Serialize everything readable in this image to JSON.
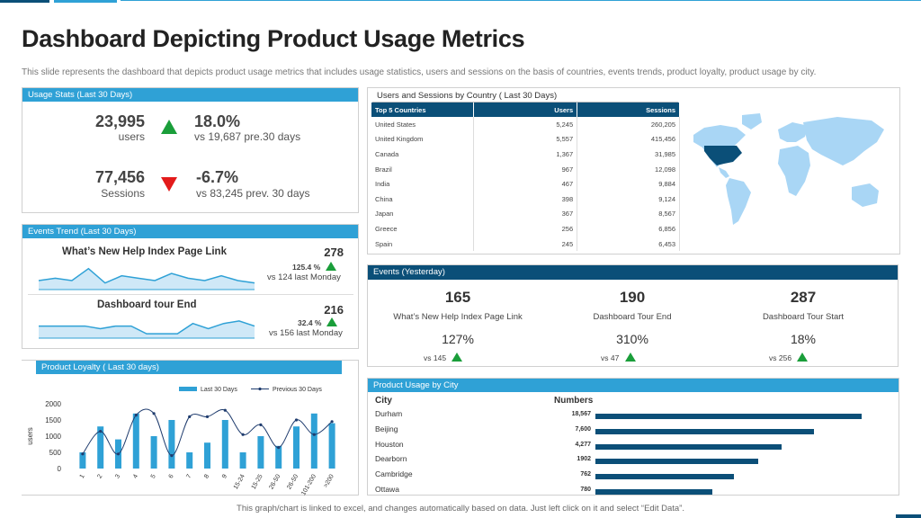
{
  "title": "Dashboard Depicting Product Usage Metrics",
  "subtitle": "This slide represents the dashboard that depicts product usage metrics that includes usage statistics, users and sessions on the basis of countries, events trends, product loyalty, product usage by city.",
  "usage_stats": {
    "header": "Usage Stats (Last 30 Days)",
    "users_value": "23,995",
    "users_label": "users",
    "users_change": "18.0%",
    "users_compare": "vs 19,687 pre.30 days",
    "sessions_value": "77,456",
    "sessions_label": "Sessions",
    "sessions_change": "-6.7%",
    "sessions_compare": "vs 83,245 prev. 30 days"
  },
  "events_trend": {
    "header": "Events Trend (Last 30 Days)",
    "item1_title": "What’s New Help Index  Page Link",
    "item1_value": "278",
    "item1_pct": "125.4 %",
    "item1_compare": "vs 124 last Monday",
    "item1_spark": [
      3,
      4,
      3,
      8,
      2,
      5,
      4,
      3,
      6,
      4,
      3,
      5,
      3,
      2
    ],
    "item2_title": "Dashboard tour End",
    "item2_value": "216",
    "item2_pct": "32.4 %",
    "item2_compare": "vs 156 last Monday",
    "item2_spark": [
      4,
      4,
      4,
      4,
      3,
      4,
      4,
      1,
      1,
      1,
      5,
      3,
      5,
      6,
      4
    ]
  },
  "users_sessions": {
    "header": "Users and Sessions by Country ( Last 30 Days)",
    "col_country": "Top 5 Countries",
    "col_users": "Users",
    "col_sessions": "Sessions",
    "rows": [
      {
        "country": "United States",
        "users": "5,245",
        "sessions": "260,205"
      },
      {
        "country": "United Kingdom",
        "users": "5,557",
        "sessions": "415,456"
      },
      {
        "country": "Canada",
        "users": "1,367",
        "sessions": "31,985"
      },
      {
        "country": "Brazil",
        "users": "967",
        "sessions": "12,098"
      },
      {
        "country": "India",
        "users": "467",
        "sessions": "9,884"
      },
      {
        "country": "China",
        "users": "398",
        "sessions": "9,124"
      },
      {
        "country": "Japan",
        "users": "367",
        "sessions": "8,567"
      },
      {
        "country": "Greece",
        "users": "256",
        "sessions": "6,856"
      },
      {
        "country": "Spain",
        "users": "245",
        "sessions": "6,453"
      }
    ],
    "map_colors": {
      "highlight": "#0b4f78",
      "land": "#a9d6f5"
    }
  },
  "events_yesterday": {
    "header": "Events (Yesterday)",
    "items": [
      {
        "value": "165",
        "label": "What’s New Help Index Page Link",
        "pct": "127%",
        "compare": "vs 145"
      },
      {
        "value": "190",
        "label": "Dashboard Tour End",
        "pct": "310%",
        "compare": "vs 47"
      },
      {
        "value": "287",
        "label": "Dashboard Tour Start",
        "pct": "18%",
        "compare": "vs 256"
      }
    ]
  },
  "product_loyalty": {
    "header": "Product Loyalty ( Last 30 days)",
    "legend_bar": "Last 30 Days",
    "legend_line": "Previous 30 Days",
    "ylabel": "users",
    "yticks": [
      "2000",
      "1500",
      "1000",
      "500",
      "0"
    ]
  },
  "chart_data": {
    "type": "bar",
    "categories": [
      "1",
      "2",
      "3",
      "4",
      "5",
      "6",
      "7",
      "8",
      "9",
      "15-24",
      "15-25",
      "26-50",
      "26-50",
      "101-200",
      ">200"
    ],
    "series": [
      {
        "name": "Last 30 Days",
        "type": "bar",
        "values": [
          500,
          1300,
          900,
          1700,
          1000,
          1500,
          500,
          800,
          1500,
          500,
          1000,
          700,
          1300,
          1700,
          1400
        ]
      },
      {
        "name": "Previous 30 Days",
        "type": "line",
        "values": [
          450,
          1150,
          450,
          1650,
          1700,
          400,
          1600,
          1600,
          1800,
          1050,
          1350,
          650,
          1500,
          1050,
          1450
        ]
      }
    ],
    "ylabel": "users",
    "ylim": [
      0,
      2000
    ],
    "legend": "top",
    "colors": {
      "bar": "#2fa1d6",
      "line": "#1f3c6e"
    }
  },
  "usage_by_city": {
    "header": "Product Usage  by City",
    "col_city": "City",
    "col_numbers": "Numbers",
    "rows": [
      {
        "city": "Durham",
        "label": "18,567",
        "value": 18567
      },
      {
        "city": "Beijing",
        "label": "7,600",
        "value": 7600
      },
      {
        "city": "Houston",
        "label": "4,277",
        "value": 4277
      },
      {
        "city": "Dearborn",
        "label": "1902",
        "value": 1902
      },
      {
        "city": "Cambridge",
        "label": "762",
        "value": 762
      },
      {
        "city": "Ottawa",
        "label": "780",
        "value": 780
      }
    ],
    "bar_fractions": [
      1.0,
      0.82,
      0.7,
      0.61,
      0.52,
      0.44
    ],
    "bar_color": "#0b4f78"
  },
  "footer": "This graph/chart is linked to excel, and changes automatically based on data. Just left click on it and select “Edit Data”.",
  "colors": {
    "accent": "#2fa1d6",
    "dark": "#0b4f78",
    "up": "#1a9e3a",
    "down": "#e31b1b"
  }
}
